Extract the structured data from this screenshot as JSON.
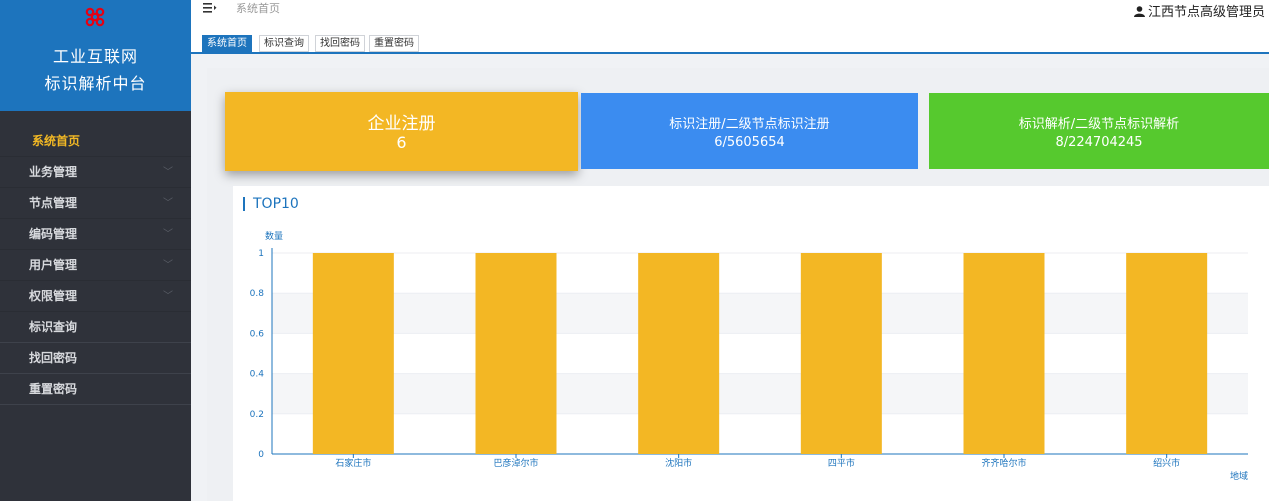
{
  "brand": {
    "line1": "工业互联网",
    "line2": "标识解析中台",
    "logo_icon": "china-unicom-knot-icon",
    "color": "#1d74bd"
  },
  "sidebar": {
    "items": [
      {
        "label": "系统首页",
        "active": true,
        "has_chevron": false
      },
      {
        "label": "业务管理",
        "has_chevron": true
      },
      {
        "label": "节点管理",
        "has_chevron": true
      },
      {
        "label": "编码管理",
        "has_chevron": true
      },
      {
        "label": "用户管理",
        "has_chevron": true
      },
      {
        "label": "权限管理",
        "has_chevron": true
      },
      {
        "label": "标识查询",
        "has_chevron": false
      },
      {
        "label": "找回密码",
        "has_chevron": false
      },
      {
        "label": "重置密码",
        "has_chevron": false
      }
    ],
    "chevron": "﹀"
  },
  "header": {
    "menu_icon": "menu-toggle-icon",
    "breadcrumb": "系统首页",
    "user": "江西节点高级管理员",
    "user_icon": "user-icon"
  },
  "tabs": [
    "系统首页",
    "标识查询",
    "找回密码",
    "重置密码"
  ],
  "cards": [
    {
      "label": "企业注册",
      "value": "6",
      "color": "#f3b724"
    },
    {
      "label": "标识注册/二级节点标识注册",
      "value": "6/5605654",
      "color": "#3b8cf0"
    },
    {
      "label": "标识解析/二级节点标识解析",
      "value": "8/224704245",
      "color": "#56c92e"
    }
  ],
  "chart_title": "TOP10",
  "chart_data": {
    "type": "bar",
    "categories": [
      "石家庄市",
      "巴彦淖尔市",
      "沈阳市",
      "四平市",
      "齐齐哈尔市",
      "绍兴市"
    ],
    "values": [
      1,
      1,
      1,
      1,
      1,
      1
    ],
    "ylabel": "数量",
    "xlabel": "地域",
    "ylim": [
      0,
      1
    ],
    "yticks": [
      "0",
      "0.2",
      "0.4",
      "0.6",
      "0.8",
      "1"
    ],
    "bar_color": "#f3b724",
    "axis_color": "#1d74bd",
    "grid": true
  }
}
